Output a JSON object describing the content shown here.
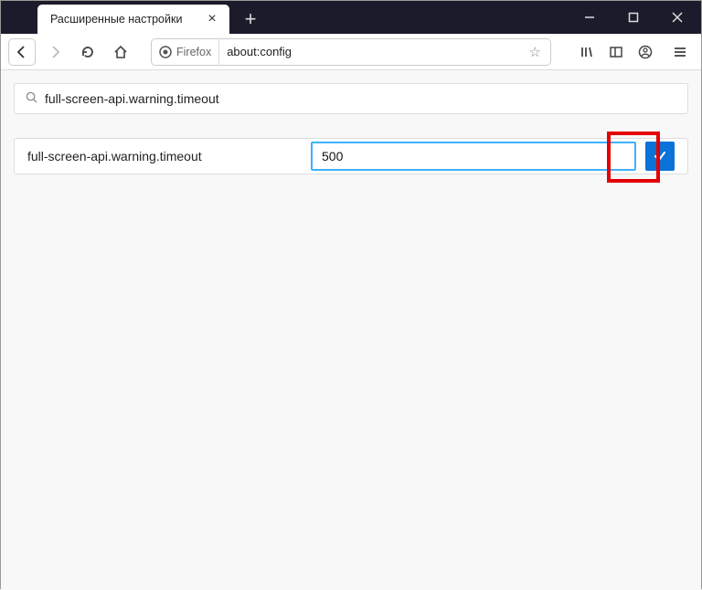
{
  "window": {
    "tab_title": "Расширенные настройки"
  },
  "navbar": {
    "identity_label": "Firefox",
    "url": "about:config"
  },
  "config": {
    "search_value": "full-screen-api.warning.timeout",
    "pref_name": "full-screen-api.warning.timeout",
    "pref_value": "500"
  },
  "colors": {
    "accent": "#0a72d9",
    "focus_border": "#3eb1ff",
    "highlight": "#e30000"
  }
}
